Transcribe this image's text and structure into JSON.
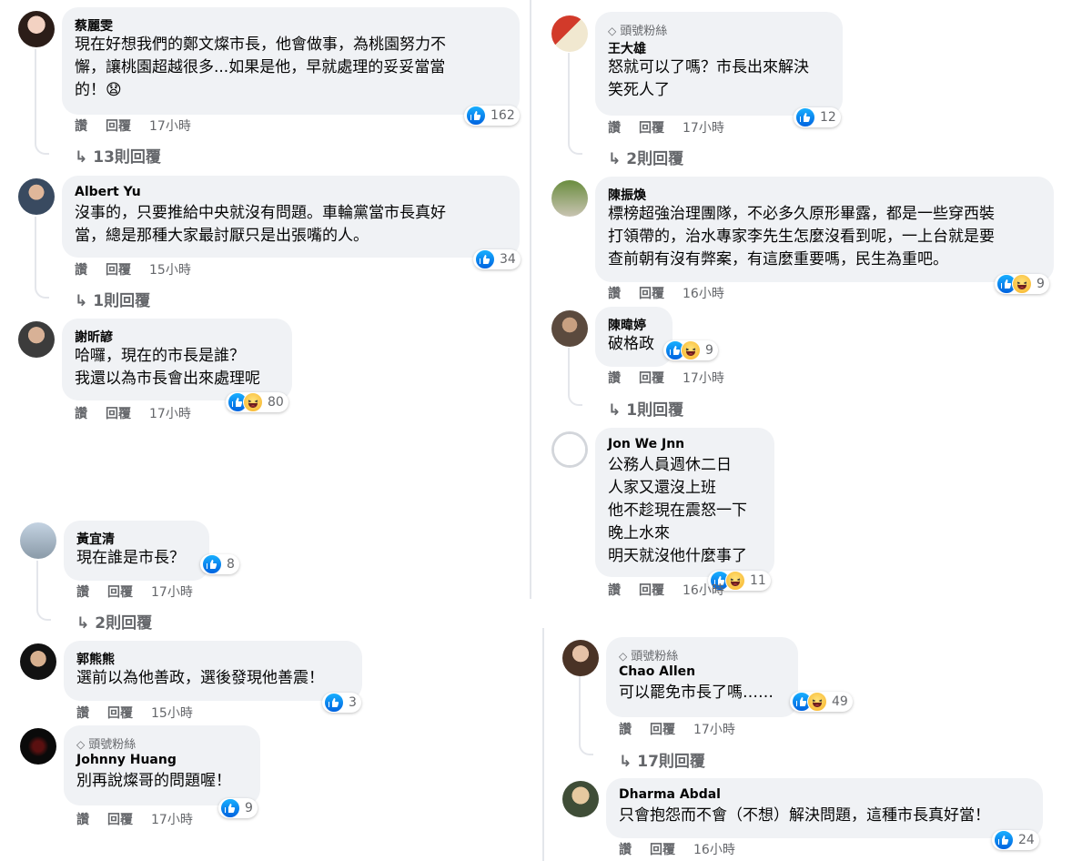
{
  "ui": {
    "like_label": "讚",
    "reply_label": "回覆",
    "top_fan_label": "頭號粉絲"
  },
  "left": [
    {
      "author": "蔡麗雯",
      "lines": [
        "現在好想我們的鄭文燦市長，他會做事，為桃園努力不",
        "懈，讓桃園超越很多...如果是他，早就處理的妥妥當當",
        "的！😧"
      ],
      "reactions": [
        "like"
      ],
      "count": "162",
      "time": "17小時",
      "replies": "13則回覆"
    },
    {
      "author": "Albert Yu",
      "lines": [
        "沒事的，只要推給中央就沒有問題。車輪黨當市長真好",
        "當，總是那種大家最討厭只是出張嘴的人。"
      ],
      "reactions": [
        "like"
      ],
      "count": "34",
      "time": "15小時",
      "replies": "1則回覆"
    },
    {
      "author": "謝昕諺",
      "lines": [
        "哈囉，現在的市長是誰？",
        "我還以為市長會出來處理呢"
      ],
      "reactions": [
        "like",
        "haha"
      ],
      "count": "80",
      "time": "17小時"
    },
    {
      "author": "黃宜清",
      "lines": [
        "現在誰是市長？"
      ],
      "reactions": [
        "like"
      ],
      "count": "8",
      "time": "17小時",
      "replies": "2則回覆"
    },
    {
      "author": "郭熊熊",
      "lines": [
        "選前以為他善政，選後發現他善震！"
      ],
      "reactions": [
        "like"
      ],
      "count": "3",
      "time": "15小時"
    },
    {
      "author": "Johnny Huang",
      "badge": true,
      "lines": [
        "別再說燦哥的問題喔！"
      ],
      "reactions": [
        "like"
      ],
      "count": "9",
      "time": "17小時"
    }
  ],
  "right": [
    {
      "author": "王大雄",
      "badge": true,
      "lines": [
        "怒就可以了嗎？市長出來解決",
        "笑死人了"
      ],
      "reactions": [
        "like"
      ],
      "count": "12",
      "time": "17小時",
      "replies": "2則回覆"
    },
    {
      "author": "陳振煥",
      "lines": [
        "標榜超強治理團隊，不必多久原形畢露，都是一些穿西裝",
        "打領帶的，治水專家李先生怎麼沒看到呢，一上台就是要",
        "查前朝有沒有弊案，有這麼重要嗎，民生為重吧。"
      ],
      "reactions": [
        "like",
        "haha"
      ],
      "count": "9",
      "time": "16小時"
    },
    {
      "author": "陳暐婷",
      "lines": [
        "破格政"
      ],
      "reactions": [
        "like",
        "haha"
      ],
      "count": "9",
      "time": "17小時",
      "replies": "1則回覆"
    },
    {
      "author": "Jon We Jnn",
      "lines": [
        "公務人員週休二日",
        "人家又還沒上班",
        "他不趁現在震怒一下",
        "晚上水來",
        "明天就沒他什麼事了"
      ],
      "reactions": [
        "like",
        "haha"
      ],
      "count": "11",
      "time": "16小時"
    },
    {
      "author": "Chao Allen",
      "badge": true,
      "lines": [
        "可以罷免市長了嗎……"
      ],
      "reactions": [
        "like",
        "haha"
      ],
      "count": "49",
      "time": "17小時",
      "replies": "17則回覆"
    },
    {
      "author": "Dharma Abdal",
      "lines": [
        "只會抱怨而不會（不想）解決問題，這種市長真好當！"
      ],
      "reactions": [
        "like"
      ],
      "count": "24",
      "time": "16小時"
    }
  ]
}
